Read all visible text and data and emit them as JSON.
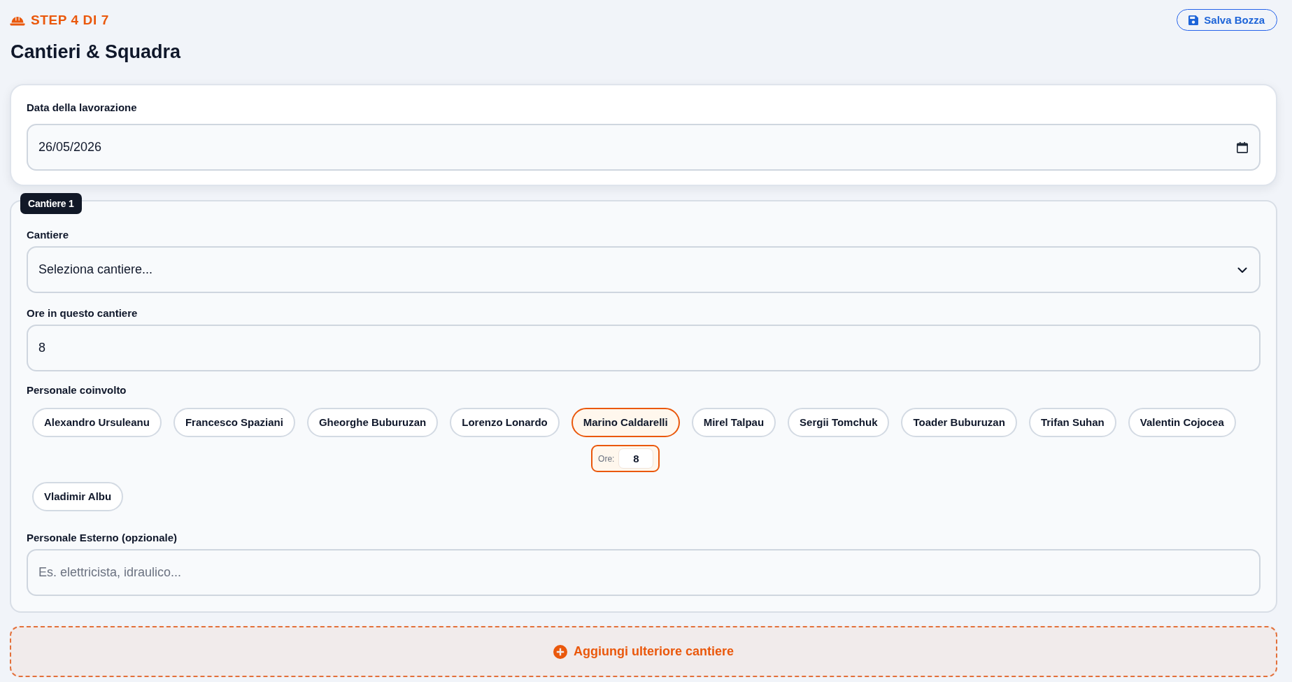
{
  "header": {
    "step": "STEP 4 DI 7",
    "title": "Cantieri & Squadra",
    "save_button": "Salva Bozza"
  },
  "date_card": {
    "label": "Data della lavorazione",
    "value": "26/05/2026"
  },
  "sites": [
    {
      "badge": "Cantiere 1",
      "site_select": {
        "label": "Cantiere",
        "value": "Seleziona cantiere..."
      },
      "hours": {
        "label": "Ore in questo cantiere",
        "value": "8"
      },
      "staff": {
        "label": "Personale coinvolto",
        "members": [
          {
            "name": "Alexandro Ursuleanu",
            "selected": false
          },
          {
            "name": "Francesco Spaziani",
            "selected": false
          },
          {
            "name": "Gheorghe Buburuzan",
            "selected": false
          },
          {
            "name": "Lorenzo Lonardo",
            "selected": false
          },
          {
            "name": "Marino Caldarelli",
            "selected": true,
            "hours_label": "Ore:",
            "hours": "8"
          },
          {
            "name": "Mirel Talpau",
            "selected": false
          },
          {
            "name": "Sergii Tomchuk",
            "selected": false
          },
          {
            "name": "Toader Buburuzan",
            "selected": false
          },
          {
            "name": "Trifan Suhan",
            "selected": false
          },
          {
            "name": "Valentin Cojocea",
            "selected": false
          },
          {
            "name": "Vladimir Albu",
            "selected": false
          }
        ]
      },
      "external": {
        "label": "Personale Esterno (opzionale)",
        "placeholder": "Es. elettricista, idraulico..."
      }
    }
  ],
  "add_site_button": "Aggiungi ulteriore cantiere"
}
